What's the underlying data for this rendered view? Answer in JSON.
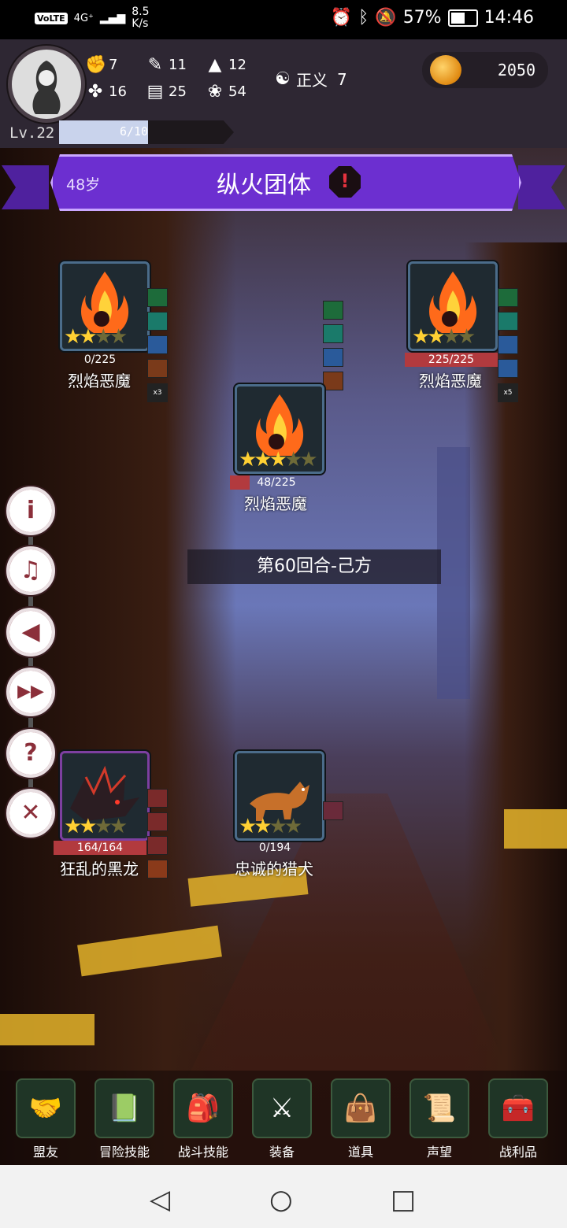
{
  "status_bar": {
    "volte": "VoLTE",
    "network": "4G⁺",
    "speed_line1": "8.5",
    "speed_line2": "K/s",
    "battery": "57%",
    "time": "14:46"
  },
  "player": {
    "stats": [
      {
        "icon": "fist-icon",
        "value": "7"
      },
      {
        "icon": "clover-icon",
        "value": "16"
      },
      {
        "icon": "pencil-icon",
        "value": "11"
      },
      {
        "icon": "book-icon",
        "value": "25"
      },
      {
        "icon": "wizard-hat-icon",
        "value": "12"
      },
      {
        "icon": "lotus-icon",
        "value": "54"
      }
    ],
    "alignment_label": "正义",
    "alignment_value": "7",
    "gold": "2050",
    "level": "Lv.22",
    "xp_text": "6/10",
    "xp_progress": 0.6
  },
  "banner": {
    "age": "48岁",
    "title": "纵火团体",
    "danger_icon": "!"
  },
  "enemies": [
    {
      "name": "烈焰恶魔",
      "hp": "0/225",
      "hp_fraction": 0,
      "stars_on": 2,
      "stars_total": 4,
      "extra": "x3"
    },
    {
      "name": "烈焰恶魔",
      "hp": "225/225",
      "hp_fraction": 1,
      "stars_on": 2,
      "stars_total": 4,
      "extra": "x5"
    },
    {
      "name": "烈焰恶魔",
      "hp": "48/225",
      "hp_fraction": 0.213,
      "stars_on": 3,
      "stars_total": 5
    }
  ],
  "turn": "第60回合-己方",
  "allies": [
    {
      "name": "狂乱的黑龙",
      "hp": "164/164",
      "hp_fraction": 1,
      "stars_on": 2,
      "stars_total": 4
    },
    {
      "name": "忠诚的猎犬",
      "hp": "0/194",
      "hp_fraction": 0,
      "stars_on": 2,
      "stars_total": 4
    }
  ],
  "side_buttons": [
    {
      "icon": "info-icon",
      "glyph": "i"
    },
    {
      "icon": "music-off-icon",
      "glyph": "♫"
    },
    {
      "icon": "sound-icon",
      "glyph": "◀"
    },
    {
      "icon": "fast-forward-icon",
      "glyph": "▶▶"
    },
    {
      "icon": "help-icon",
      "glyph": "?"
    },
    {
      "icon": "close-icon",
      "glyph": "✕"
    }
  ],
  "bottom_nav": [
    {
      "label": "盟友",
      "icon": "handshake-icon",
      "glyph": "🤝"
    },
    {
      "label": "冒险技能",
      "icon": "spellbook-icon",
      "glyph": "📗"
    },
    {
      "label": "战斗技能",
      "icon": "backpack-icon",
      "glyph": "🎒"
    },
    {
      "label": "装备",
      "icon": "crossed-swords-icon",
      "glyph": "⚔"
    },
    {
      "label": "道具",
      "icon": "satchel-icon",
      "glyph": "👜"
    },
    {
      "label": "声望",
      "icon": "scroll-icon",
      "glyph": "📜"
    },
    {
      "label": "战利品",
      "icon": "treasure-chest-icon",
      "glyph": "🧰"
    }
  ],
  "colors": {
    "banner": "#6c2fd0",
    "hp_red": "#b23a3e",
    "star_on": "#ffd033",
    "side_button": "#8b2f3a"
  }
}
